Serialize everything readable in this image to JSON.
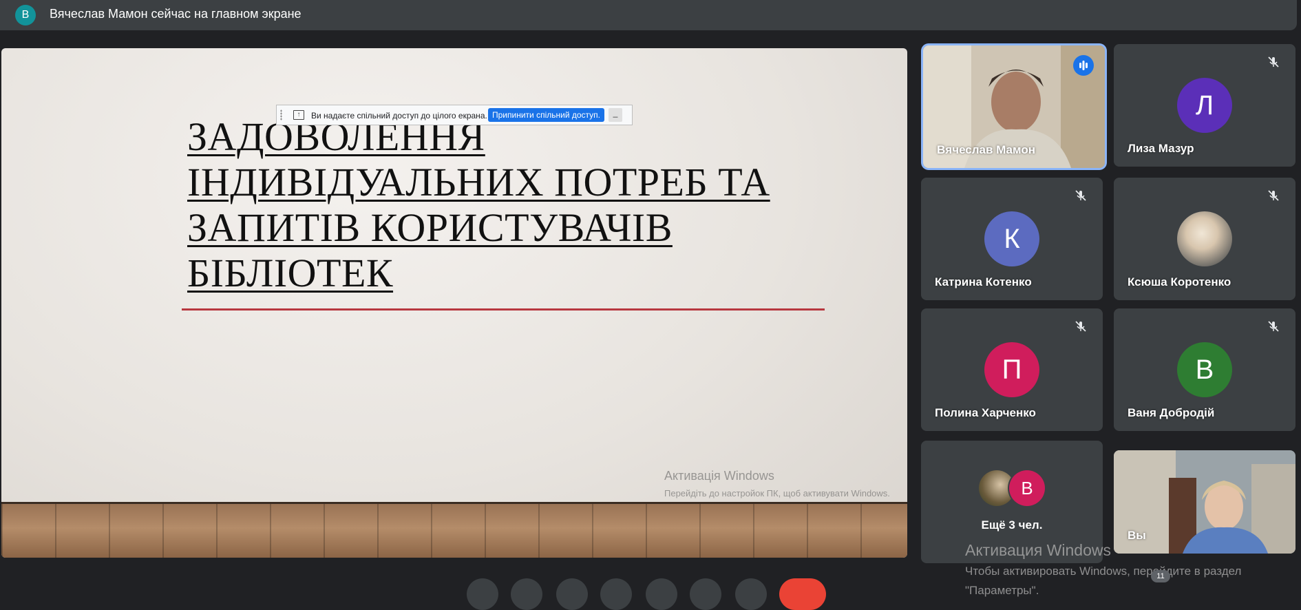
{
  "header": {
    "presenter_initial": "В",
    "title": "Вячеслав Мамон сейчас на главном экране"
  },
  "slide": {
    "title_lines": [
      "ЗАДОВОЛЕННЯ",
      "ІНДИВІДУАЛЬНИХ ПОТРЕБ ТА",
      "ЗАПИТІВ КОРИСТУВАЧІВ",
      "БІБЛІОТЕК"
    ],
    "accent_line_color": "#b7373f",
    "watermark_title": "Активація Windows",
    "watermark_text": "Перейдіть до настройок ПК, щоб активувати Windows."
  },
  "share_bar": {
    "message": "Ви надаєте спільний доступ до цілого екрана.",
    "stop_label": "Припинити спільний доступ.",
    "hide_label": "_"
  },
  "participants": [
    {
      "name": "Вячеслав Мамон",
      "type": "video",
      "speaking": true
    },
    {
      "name": "Лиза Мазур",
      "initial": "Л",
      "color": "#5b2fb8",
      "muted": true
    },
    {
      "name": "Катрина Котенко",
      "initial": "К",
      "color": "#5c6bc0",
      "muted": true
    },
    {
      "name": "Ксюша Коротенко",
      "type": "photo",
      "muted": true
    },
    {
      "name": "Полина Харченко",
      "initial": "П",
      "color": "#d01d5c",
      "muted": true
    },
    {
      "name": "Ваня Добродій",
      "initial": "В",
      "color": "#2e7d32",
      "muted": true
    },
    {
      "name": "Ещё 3 чел.",
      "stack_initial": "В"
    },
    {
      "name": "Вы",
      "type": "video"
    }
  ],
  "os_watermark": {
    "title": "Активация Windows",
    "text_line1": "Чтобы активировать Windows, перейдите в раздел",
    "text_line2": "\"Параметры\"."
  },
  "participant_count": "11",
  "colors": {
    "accent_blue": "#1a73e8",
    "tile_bg": "#3c4043",
    "page_bg": "#202124",
    "end_call": "#ea4335"
  }
}
